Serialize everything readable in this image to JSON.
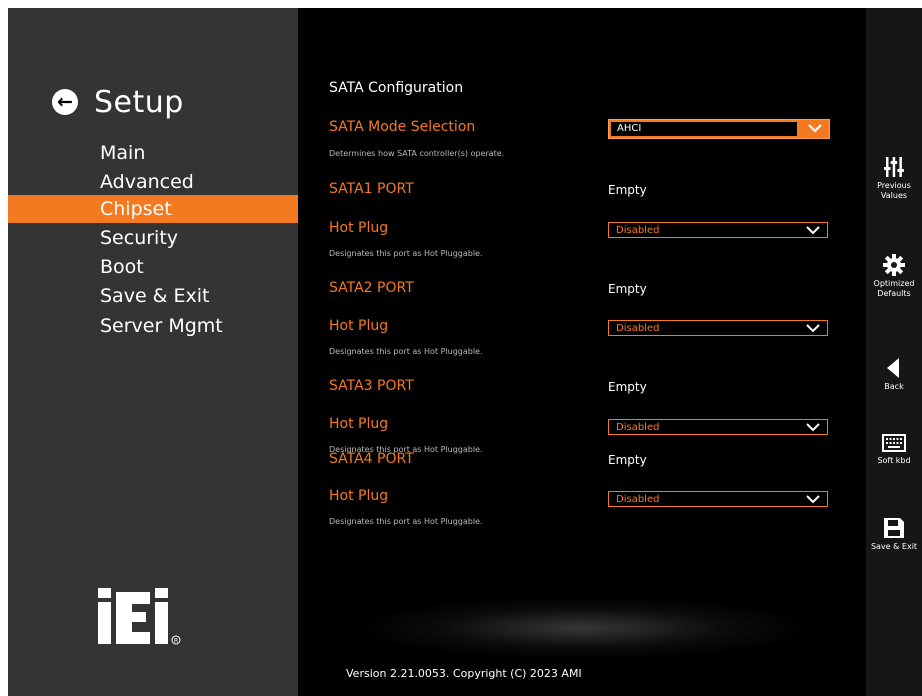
{
  "nav": {
    "back_glyph": "←",
    "title": "Setup",
    "items": [
      "Main",
      "Advanced",
      "Chipset",
      "Security",
      "Boot",
      "Save & Exit",
      "Server Mgmt"
    ],
    "active_item": "Chipset"
  },
  "colors": {
    "accent": "#f47920",
    "sidebar_bg": "#343434",
    "main_bg": "#000000",
    "right_bg": "#161616"
  },
  "main": {
    "section_title": "SATA Configuration",
    "mode": {
      "label": "SATA Mode Selection",
      "description": "Determines how SATA controller(s) operate.",
      "value": "AHCI"
    },
    "ports": [
      {
        "name": "SATA1 PORT",
        "status": "Empty",
        "hot_plug_label": "Hot Plug",
        "hot_plug_desc": "Designates this port as Hot Pluggable.",
        "hot_plug_value": "Disabled"
      },
      {
        "name": "SATA2 PORT",
        "status": "Empty",
        "hot_plug_label": "Hot Plug",
        "hot_plug_desc": "Designates this port as Hot Pluggable.",
        "hot_plug_value": "Disabled"
      },
      {
        "name": "SATA3 PORT",
        "status": "Empty",
        "hot_plug_label": "Hot Plug",
        "hot_plug_desc": "Designates this port as Hot Pluggable.",
        "hot_plug_value": "Disabled"
      },
      {
        "name": "SATA4 PORT",
        "status": "Empty",
        "hot_plug_label": "Hot Plug",
        "hot_plug_desc": "Designates this port as Hot Pluggable.",
        "hot_plug_value": "Disabled"
      }
    ],
    "version": "Version 2.21.0053. Copyright (C) 2023 AMI"
  },
  "right_panel": [
    {
      "icon": "sliders-icon",
      "label_line1": "Previous",
      "label_line2": "Values"
    },
    {
      "icon": "gear-icon",
      "label_line1": "Optimized",
      "label_line2": "Defaults"
    },
    {
      "icon": "back-triangle-icon",
      "label_line1": "Back",
      "label_line2": ""
    },
    {
      "icon": "keyboard-icon",
      "label_line1": "Soft kbd",
      "label_line2": ""
    },
    {
      "icon": "save-disk-icon",
      "label_line1": "Save & Exit",
      "label_line2": ""
    }
  ],
  "logo_text": "iEi"
}
